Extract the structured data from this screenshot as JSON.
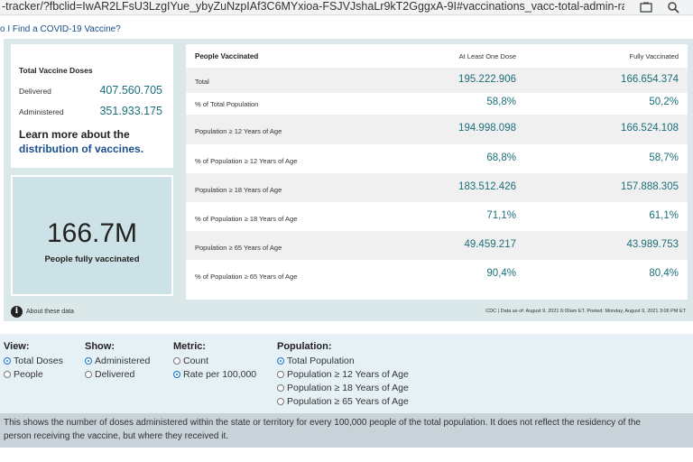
{
  "browser": {
    "url": "-tracker/?fbclid=IwAR2LFsU3LzgIYue_ybyZuNzpIAf3C6MYxioa-FSJVJshaLr9kT2GggxA-9I#vaccinations_vacc-total-admin-rat..."
  },
  "breadcrumb": "o I Find a COVID-19 Vaccine?",
  "doses_card": {
    "title": "Total Vaccine Doses",
    "delivered_label": "Delivered",
    "delivered_value": "407.560.705",
    "administered_label": "Administered",
    "administered_value": "351.933.175",
    "learn_text": "Learn more about the",
    "learn_link": "distribution of vaccines."
  },
  "big_card": {
    "value": "166.7M",
    "label": "People fully vaccinated"
  },
  "table": {
    "headers": [
      "People Vaccinated",
      "At Least One Dose",
      "Fully Vaccinated"
    ],
    "rows": [
      {
        "label": "Total",
        "one_dose": "195.222.906",
        "fully": "166.654.374"
      },
      {
        "label": "% of Total Population",
        "one_dose": "58,8%",
        "fully": "50,2%"
      },
      {
        "label": "Population ≥ 12 Years of Age",
        "one_dose": "194.998.098",
        "fully": "166.524.108"
      },
      {
        "label": "% of Population ≥ 12 Years of Age",
        "one_dose": "68,8%",
        "fully": "58,7%"
      },
      {
        "label": "Population ≥ 18 Years of Age",
        "one_dose": "183.512.426",
        "fully": "157.888.305"
      },
      {
        "label": "% of Population ≥ 18 Years of Age",
        "one_dose": "71,1%",
        "fully": "61,1%"
      },
      {
        "label": "Population ≥ 65 Years of Age",
        "one_dose": "49.459.217",
        "fully": "43.989.753"
      },
      {
        "label": "% of Population ≥ 65 Years of Age",
        "one_dose": "90,4%",
        "fully": "80,4%"
      }
    ]
  },
  "footer": {
    "about": "About these data",
    "source": "CDC | Data as of: August 9, 2021 6:00am ET. Posted: Monday, August 9, 2021 3:06 PM ET"
  },
  "controls": {
    "view": {
      "title": "View:",
      "options": [
        "Total Doses",
        "People"
      ],
      "selected": 0
    },
    "show": {
      "title": "Show:",
      "options": [
        "Administered",
        "Delivered"
      ],
      "selected": 0
    },
    "metric": {
      "title": "Metric:",
      "options": [
        "Count",
        "Rate per 100,000"
      ],
      "selected": 1
    },
    "population": {
      "title": "Population:",
      "options": [
        "Total Population",
        "Population ≥ 12 Years of Age",
        "Population ≥ 18 Years of Age",
        "Population ≥ 65 Years of Age"
      ],
      "selected": 0
    }
  },
  "note": {
    "line1": "This shows the number of doses administered within the state or territory for every 100,000 people of the total population. It does not reflect the residency of the",
    "line2": "person receiving the vaccine, but where they received it."
  },
  "colors": {
    "accent": "#1b6f7a",
    "link": "#1a4f8a",
    "panel": "#dbe8ea",
    "radio": "#1877d0"
  }
}
